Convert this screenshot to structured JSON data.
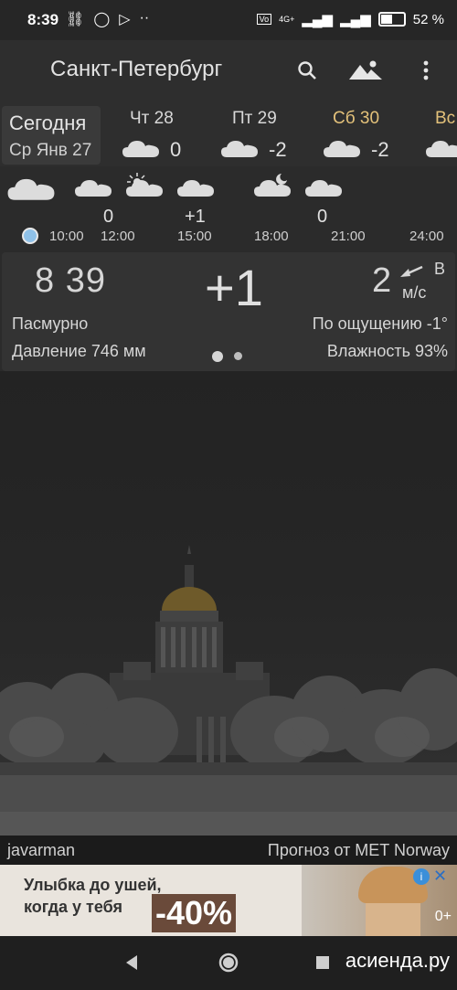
{
  "status_bar": {
    "time": "8:39",
    "battery": "52 %",
    "network": "4G+"
  },
  "app_bar": {
    "city": "Санкт-Петербург",
    "icons": [
      "search-icon",
      "landscape-icon",
      "more-vert-icon"
    ]
  },
  "days": {
    "today": {
      "label": "Сегодня",
      "date": "Ср Янв 27"
    },
    "items": [
      {
        "name": "Чт 28",
        "temp": "0",
        "weekend": false
      },
      {
        "name": "Пт 29",
        "temp": "-2",
        "weekend": false
      },
      {
        "name": "Сб 30",
        "temp": "-2",
        "weekend": true
      },
      {
        "name": "Вс",
        "temp": "",
        "weekend": true
      }
    ]
  },
  "hourly": {
    "temps": [
      "0",
      "+1",
      "0"
    ],
    "times": [
      "10:00",
      "12:00",
      "15:00",
      "18:00",
      "21:00",
      "24:00"
    ]
  },
  "current": {
    "time": "8 39",
    "temp": "+1",
    "wind_speed": "2",
    "wind_dir": "В",
    "wind_unit": "м/с",
    "condition": "Пасмурно",
    "feels_like": "По ощущению -1°",
    "pressure": "Давление 746 мм",
    "humidity": "Влажность 93%"
  },
  "footer": {
    "author": "javarman",
    "source": "Прогноз от MET Norway"
  },
  "ad": {
    "line1": "Улыбка до ушей,",
    "line2": "когда у тебя",
    "discount": "-40%",
    "age": "0+"
  },
  "watermark": "асиенда.ру",
  "colors": {
    "accent_weekend": "#e3c17a",
    "background": "#2b2b2b",
    "now_dot": "#8fc1e8"
  }
}
